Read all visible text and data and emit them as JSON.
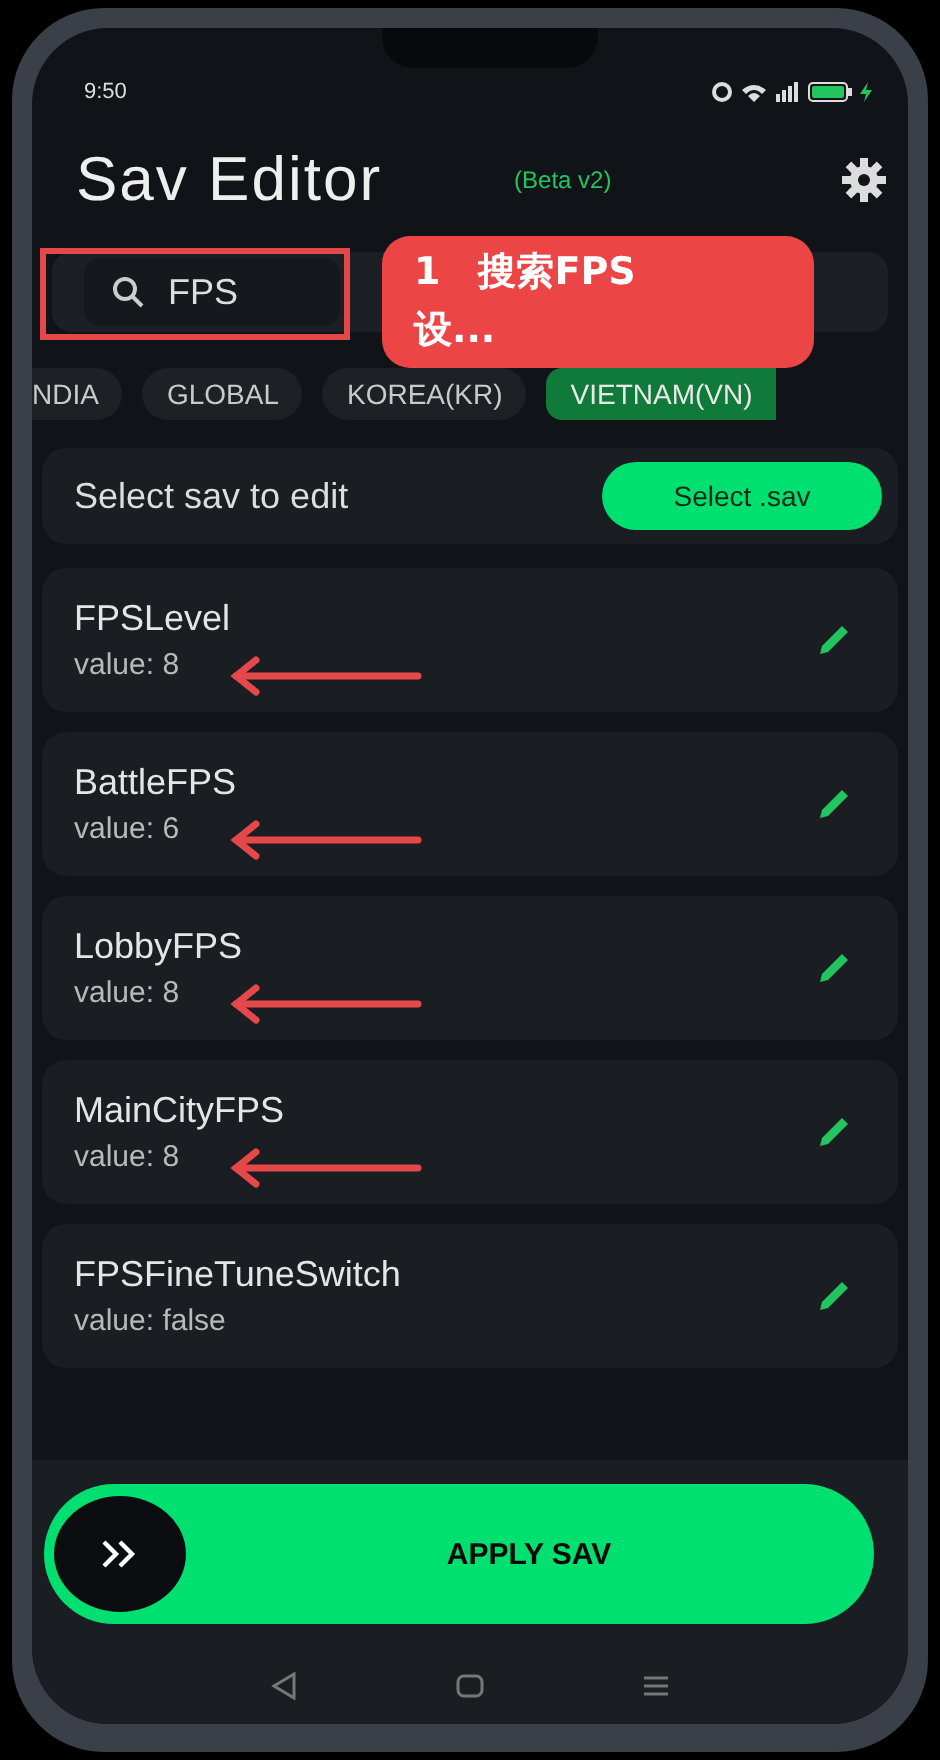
{
  "status_bar": {
    "time": "9:50"
  },
  "header": {
    "title": "Sav Editor",
    "badge": "(Beta v2)"
  },
  "search": {
    "value": "FPS",
    "highlighted": true
  },
  "callout": {
    "text": "1　搜索FPS设..."
  },
  "regions": [
    {
      "label": "NDIA",
      "selected": false
    },
    {
      "label": "GLOBAL",
      "selected": false
    },
    {
      "label": "KOREA(KR)",
      "selected": false
    },
    {
      "label": "VIETNAM(VN)",
      "selected": true
    }
  ],
  "file_row": {
    "label": "Select sav to edit",
    "button": "Select .sav"
  },
  "entries": [
    {
      "name": "FPSLevel",
      "value": "value: 8",
      "arrow": true
    },
    {
      "name": "BattleFPS",
      "value": "value: 6",
      "arrow": true
    },
    {
      "name": "LobbyFPS",
      "value": "value: 8",
      "arrow": true
    },
    {
      "name": "MainCityFPS",
      "value": "value: 8",
      "arrow": true
    },
    {
      "name": "FPSFineTuneSwitch",
      "value": "value: false",
      "arrow": false
    }
  ],
  "apply": {
    "label": "APPLY SAV",
    "level": 0
  }
}
